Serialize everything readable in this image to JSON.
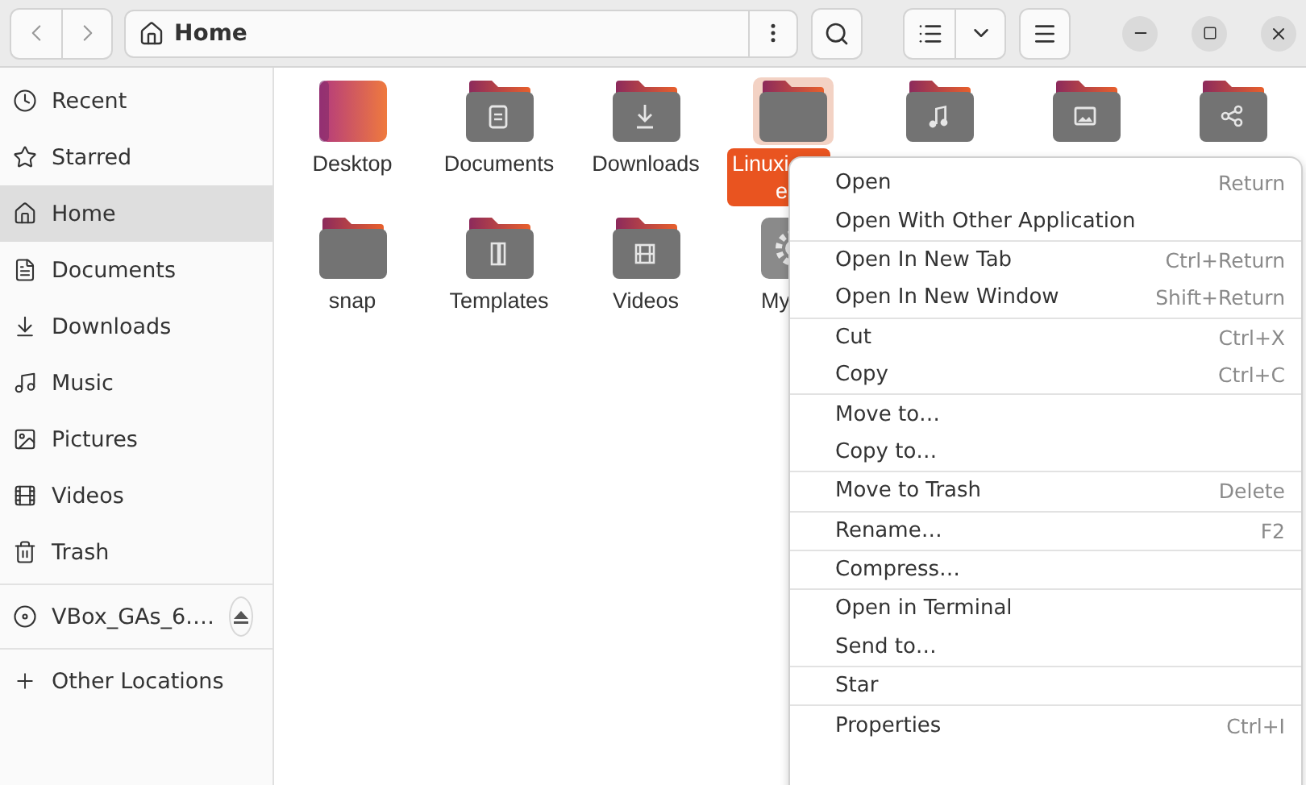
{
  "path_bar": {
    "label": "Home"
  },
  "sidebar": {
    "places": [
      {
        "label": "Recent",
        "kind": "recent",
        "selected": false
      },
      {
        "label": "Starred",
        "kind": "starred",
        "selected": false
      },
      {
        "label": "Home",
        "kind": "home",
        "selected": true
      },
      {
        "label": "Documents",
        "kind": "documents",
        "selected": false
      },
      {
        "label": "Downloads",
        "kind": "downloads",
        "selected": false
      },
      {
        "label": "Music",
        "kind": "music",
        "selected": false
      },
      {
        "label": "Pictures",
        "kind": "pictures",
        "selected": false
      },
      {
        "label": "Videos",
        "kind": "videos",
        "selected": false
      },
      {
        "label": "Trash",
        "kind": "trash",
        "selected": false
      }
    ],
    "devices": [
      {
        "label": "VBox_GAs_6.…"
      }
    ],
    "other": {
      "label": "Other Locations"
    }
  },
  "files": [
    {
      "label": "Desktop",
      "kind": "desktop",
      "selected": false
    },
    {
      "label": "Documents",
      "kind": "documents",
      "selected": false
    },
    {
      "label": "Downloads",
      "kind": "downloads",
      "selected": false
    },
    {
      "label": "Linuxi",
      "label_line_2": "e",
      "kind": "plain",
      "selected": true
    },
    {
      "kind": "music"
    },
    {
      "kind": "pictures"
    },
    {
      "kind": "public"
    },
    {
      "label": "snap",
      "kind": "plain",
      "selected": false
    },
    {
      "label": "Templates",
      "kind": "templates",
      "selected": false
    },
    {
      "label": "Videos",
      "kind": "videos",
      "selected": false
    },
    {
      "label": "My",
      "kind": "settings",
      "selected": false
    }
  ],
  "context_menu": [
    [
      {
        "label": "Open",
        "shortcut": "Return"
      },
      {
        "label": "Open With Other Application"
      }
    ],
    [
      {
        "label": "Open In New Tab",
        "shortcut": "Ctrl+Return"
      },
      {
        "label": "Open In New Window",
        "shortcut": "Shift+Return"
      }
    ],
    [
      {
        "label": "Cut",
        "shortcut": "Ctrl+X"
      },
      {
        "label": "Copy",
        "shortcut": "Ctrl+C"
      }
    ],
    [
      {
        "label": "Move to…"
      },
      {
        "label": "Copy to…"
      }
    ],
    [
      {
        "label": "Move to Trash",
        "shortcut": "Delete"
      }
    ],
    [
      {
        "label": "Rename…",
        "shortcut": "F2"
      }
    ],
    [
      {
        "label": "Compress…"
      }
    ],
    [
      {
        "label": "Open in Terminal"
      },
      {
        "label": "Send to…"
      }
    ],
    [
      {
        "label": "Star"
      }
    ],
    [
      {
        "label": "Properties",
        "shortcut": "Ctrl+I"
      }
    ]
  ]
}
